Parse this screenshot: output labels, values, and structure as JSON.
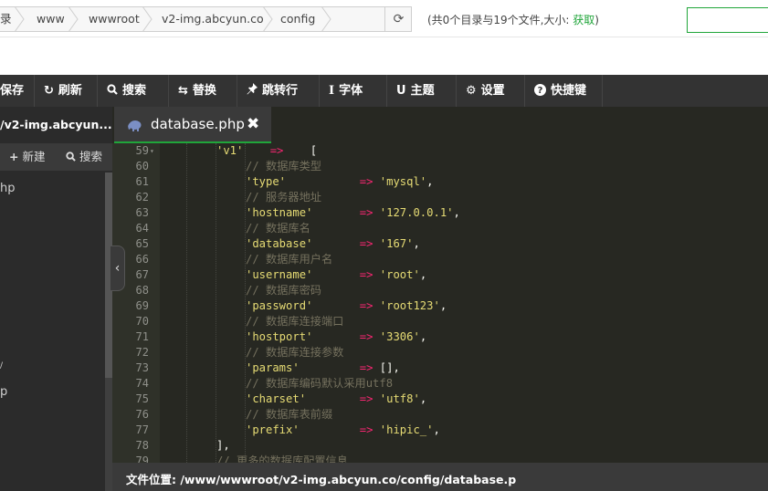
{
  "breadcrumb": {
    "items": [
      "录",
      "www",
      "wwwroot",
      "v2-img.abcyun.co",
      "config"
    ]
  },
  "dir_info": {
    "text": "(共0个目录与19个文件,大小: ",
    "link": "获取",
    "suffix": ")"
  },
  "toolbar": {
    "buttons": [
      {
        "label": "保存",
        "icon": "save-icon"
      },
      {
        "label": "刷新",
        "icon": "refresh-icon",
        "glyph": "↻"
      },
      {
        "label": "搜索",
        "icon": "search-icon",
        "glyph": "🔍"
      },
      {
        "label": "替换",
        "icon": "replace-icon",
        "glyph": "⇆"
      },
      {
        "label": "跳转行",
        "icon": "pin-icon",
        "glyph": "✈"
      },
      {
        "label": "字体",
        "icon": "font-icon",
        "glyph": "I"
      },
      {
        "label": "主题",
        "icon": "theme-icon",
        "glyph": "U"
      },
      {
        "label": "设置",
        "icon": "gear-icon",
        "glyph": "⚙"
      },
      {
        "label": "快捷键",
        "icon": "help-icon",
        "glyph": "?"
      }
    ]
  },
  "sidebar": {
    "title": "/v2-img.abcyun....",
    "actions": {
      "new_label": "新建",
      "search_label": "搜索"
    },
    "files": [
      "hp",
      "/",
      "p"
    ]
  },
  "tab": {
    "label": "database.php",
    "close": "✖"
  },
  "editor": {
    "lines": [
      {
        "n": "59",
        "fold": true,
        "key": "'v1'",
        "op": "=>",
        "rest": "    [",
        "type": "arrayopen"
      },
      {
        "n": "60",
        "comment": "// 数据库类型"
      },
      {
        "n": "61",
        "key": "'type'",
        "pad": "           ",
        "op": "=>",
        "val": "'mysql'",
        "tail": ","
      },
      {
        "n": "62",
        "comment": "// 服务器地址"
      },
      {
        "n": "63",
        "key": "'hostname'",
        "pad": "       ",
        "op": "=>",
        "val": "'127.0.0.1'",
        "tail": ","
      },
      {
        "n": "64",
        "comment": "// 数据库名"
      },
      {
        "n": "65",
        "key": "'database'",
        "pad": "       ",
        "op": "=>",
        "val": "'167'",
        "tail": ","
      },
      {
        "n": "66",
        "comment": "// 数据库用户名"
      },
      {
        "n": "67",
        "key": "'username'",
        "pad": "       ",
        "op": "=>",
        "val": "'root'",
        "tail": ","
      },
      {
        "n": "68",
        "comment": "// 数据库密码"
      },
      {
        "n": "69",
        "key": "'password'",
        "pad": "       ",
        "op": "=>",
        "val": "'root123'",
        "tail": ","
      },
      {
        "n": "70",
        "comment": "// 数据库连接端口"
      },
      {
        "n": "71",
        "key": "'hostport'",
        "pad": "       ",
        "op": "=>",
        "val": "'3306'",
        "tail": ","
      },
      {
        "n": "72",
        "comment": "// 数据库连接参数"
      },
      {
        "n": "73",
        "key": "'params'",
        "pad": "         ",
        "op": "=>",
        "val": "",
        "tail": "[],"
      },
      {
        "n": "74",
        "comment": "// 数据库编码默认采用utf8"
      },
      {
        "n": "75",
        "key": "'charset'",
        "pad": "        ",
        "op": "=>",
        "val": "'utf8'",
        "tail": ","
      },
      {
        "n": "76",
        "comment": "// 数据库表前缀"
      },
      {
        "n": "77",
        "key": "'prefix'",
        "pad": "         ",
        "op": "=>",
        "val": "'hipic_'",
        "tail": ","
      },
      {
        "n": "78",
        "plain": "],",
        "outdent": true
      },
      {
        "n": "79",
        "comment": "// 更多的数据库配置信息",
        "outdent": true
      }
    ]
  },
  "status": {
    "label": "文件位置: /www/wwwroot/v2-img.abcyun.co/config/database.p"
  }
}
